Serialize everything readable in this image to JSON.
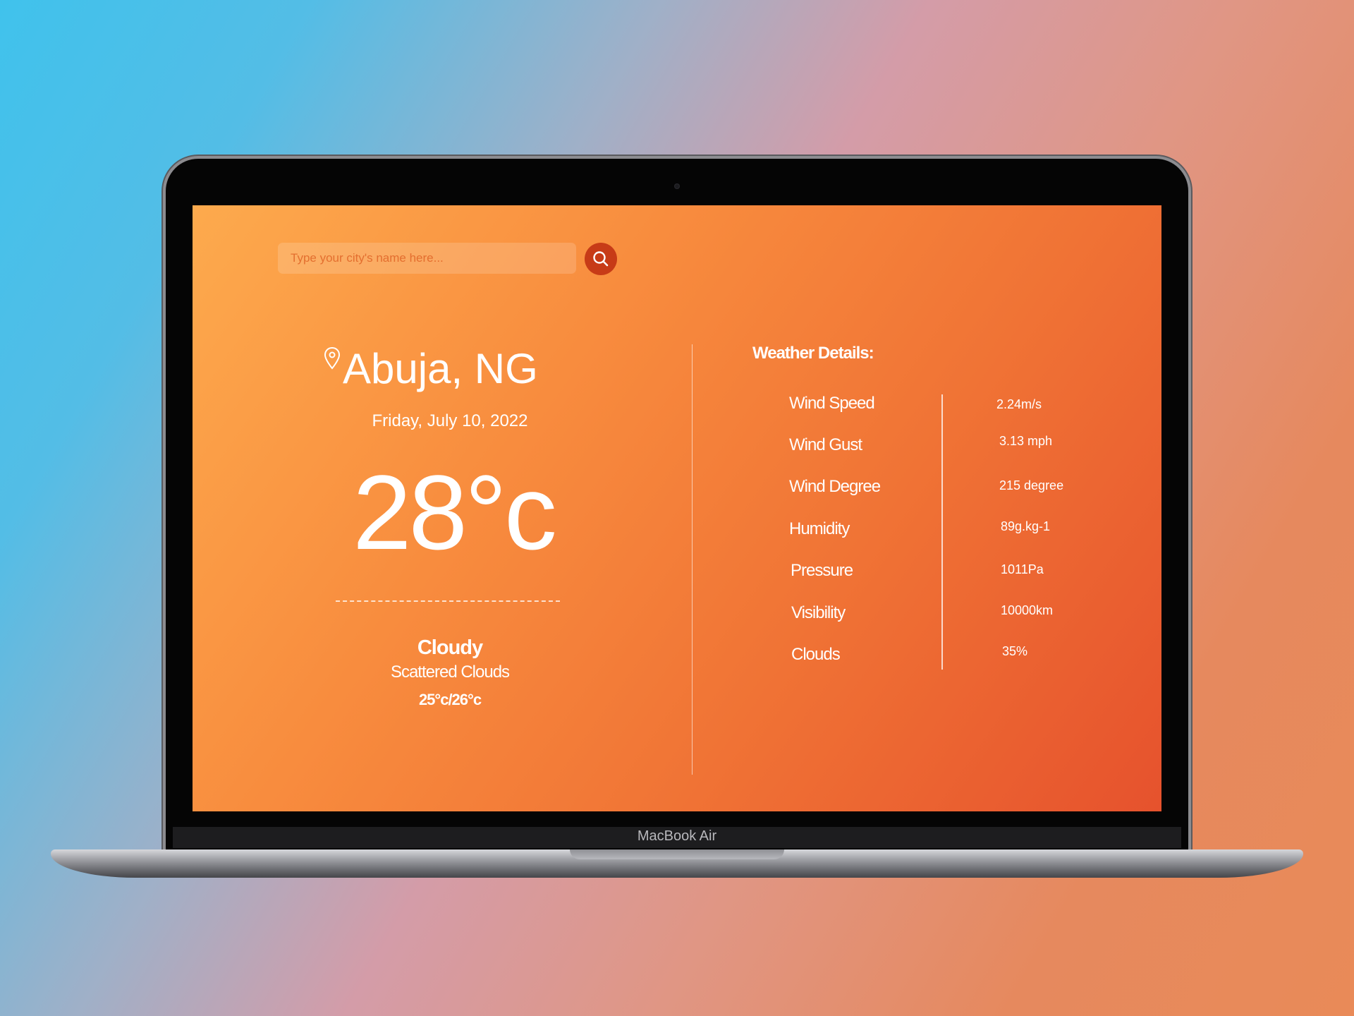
{
  "device": {
    "brand_label": "MacBook Air"
  },
  "search": {
    "placeholder": "Type your city's name here..."
  },
  "location": {
    "city": "Abuja, NG",
    "date": "Friday, July 10, 2022"
  },
  "current": {
    "temperature": "28°c",
    "condition": "Cloudy",
    "description": "Scattered Clouds",
    "range": "25°c/26°c"
  },
  "details": {
    "title": "Weather Details:",
    "rows": [
      {
        "label": "Wind Speed",
        "value": "2.24m/s"
      },
      {
        "label": "Wind Gust",
        "value": "3.13 mph"
      },
      {
        "label": "Wind Degree",
        "value": "215 degree"
      },
      {
        "label": "Humidity",
        "value": "89g.kg-1"
      },
      {
        "label": "Pressure",
        "value": "1011Pa"
      },
      {
        "label": "Visibility",
        "value": "10000km"
      },
      {
        "label": "Clouds",
        "value": "35%"
      }
    ]
  },
  "colors": {
    "screen_gradient_start": "#fdaa4d",
    "screen_gradient_end": "#e6522d",
    "search_button": "#c73b17",
    "text": "#ffffff"
  }
}
